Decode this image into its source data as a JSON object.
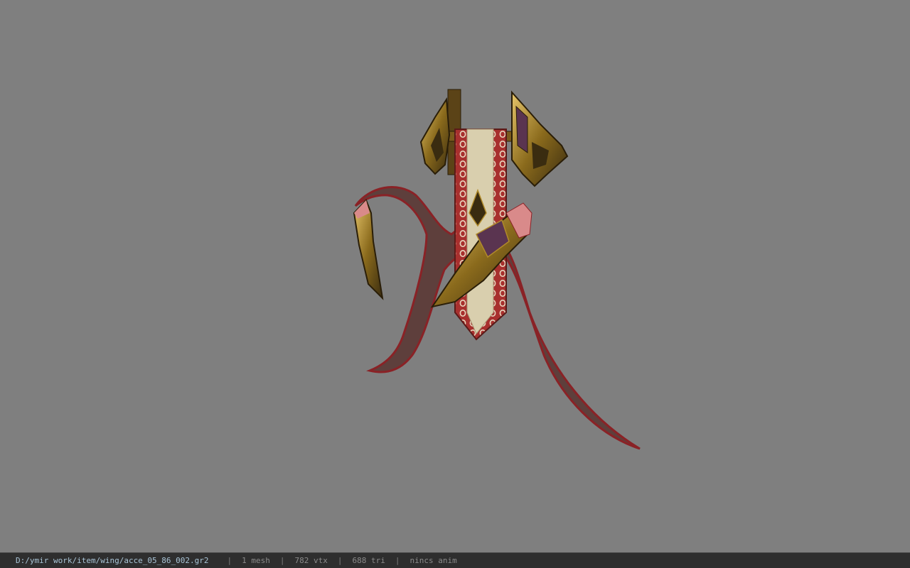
{
  "viewer": {
    "background_color": "#7f7f7f",
    "model_icon": "wing-accessory-model",
    "model_colors": {
      "ribbon": "#5e3f3c",
      "ribbon_edge": "#8a2226",
      "banner_red": "#a8302e",
      "banner_cream": "#d9cfae",
      "gold": "#b08a2a",
      "dark_gold": "#3a2c10",
      "purple": "#5a3450",
      "pink": "#d98a8a"
    }
  },
  "status_bar": {
    "file_path": "D:/ymir work/item/wing/acce_05_86_002.gr2",
    "separator": "|",
    "mesh_count": "1 mesh",
    "vertex_count": "782 vtx",
    "triangle_count": "688 tri",
    "animation": "nincs anim"
  }
}
